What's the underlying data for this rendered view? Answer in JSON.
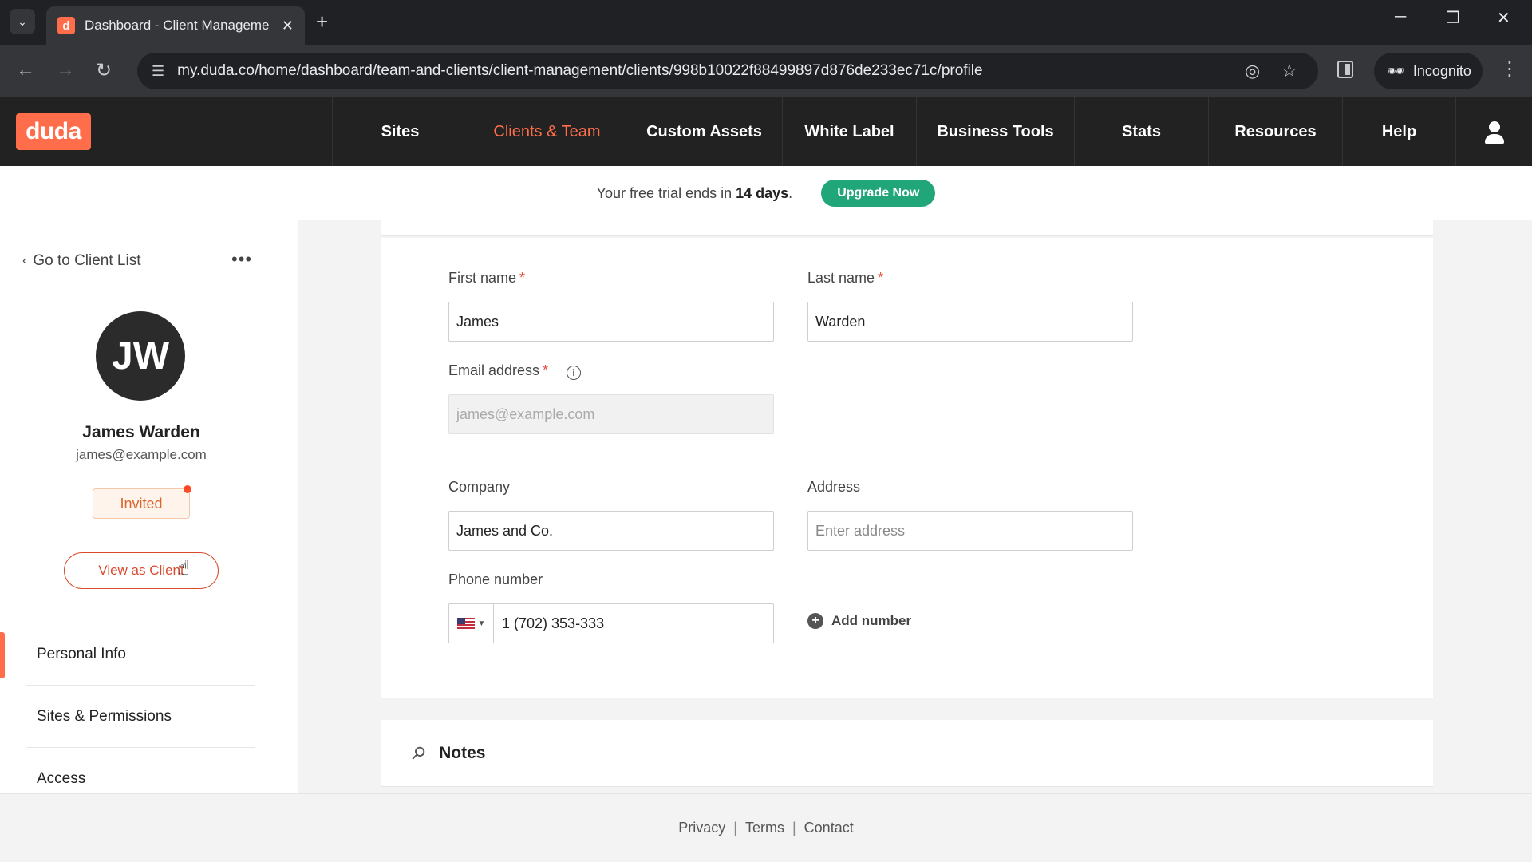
{
  "browser": {
    "tab_title": "Dashboard - Client Manageme",
    "favicon_letter": "d",
    "url": "my.duda.co/home/dashboard/team-and-clients/client-management/clients/998b10022f88499897d876de233ec71c/profile",
    "incognito_label": "Incognito"
  },
  "nav": {
    "logo": "duda",
    "items": [
      "Sites",
      "Clients & Team",
      "Custom Assets",
      "White Label",
      "Business Tools",
      "Stats",
      "Resources",
      "Help"
    ],
    "active": "Clients & Team"
  },
  "trial": {
    "text_prefix": "Your free trial ends in ",
    "days": "14 days",
    "text_suffix": ".",
    "upgrade_label": "Upgrade Now"
  },
  "sidebar": {
    "back_label": "Go to Client List",
    "more_label": "•••",
    "initials": "JW",
    "name": "James Warden",
    "email": "james@example.com",
    "status": "Invited",
    "view_as_label": "View as Client",
    "menu": [
      "Personal Info",
      "Sites & Permissions",
      "Access"
    ]
  },
  "form": {
    "first_name": {
      "label": "First name",
      "required": "*",
      "value": "James"
    },
    "last_name": {
      "label": "Last name",
      "required": "*",
      "value": "Warden"
    },
    "email": {
      "label": "Email address",
      "required": "*",
      "placeholder": "james@example.com"
    },
    "company": {
      "label": "Company",
      "value": "James and Co."
    },
    "address": {
      "label": "Address",
      "placeholder": "Enter address"
    },
    "phone": {
      "label": "Phone number",
      "value": "1 (702) 353-333"
    },
    "add_number_label": "Add number"
  },
  "notes": {
    "title": "Notes"
  },
  "footer": {
    "privacy": "Privacy",
    "terms": "Terms",
    "contact": "Contact",
    "separator": "|"
  },
  "colors": {
    "accent": "#ff6d4a",
    "upgrade": "#21a67a",
    "nav_bg": "#222222"
  }
}
